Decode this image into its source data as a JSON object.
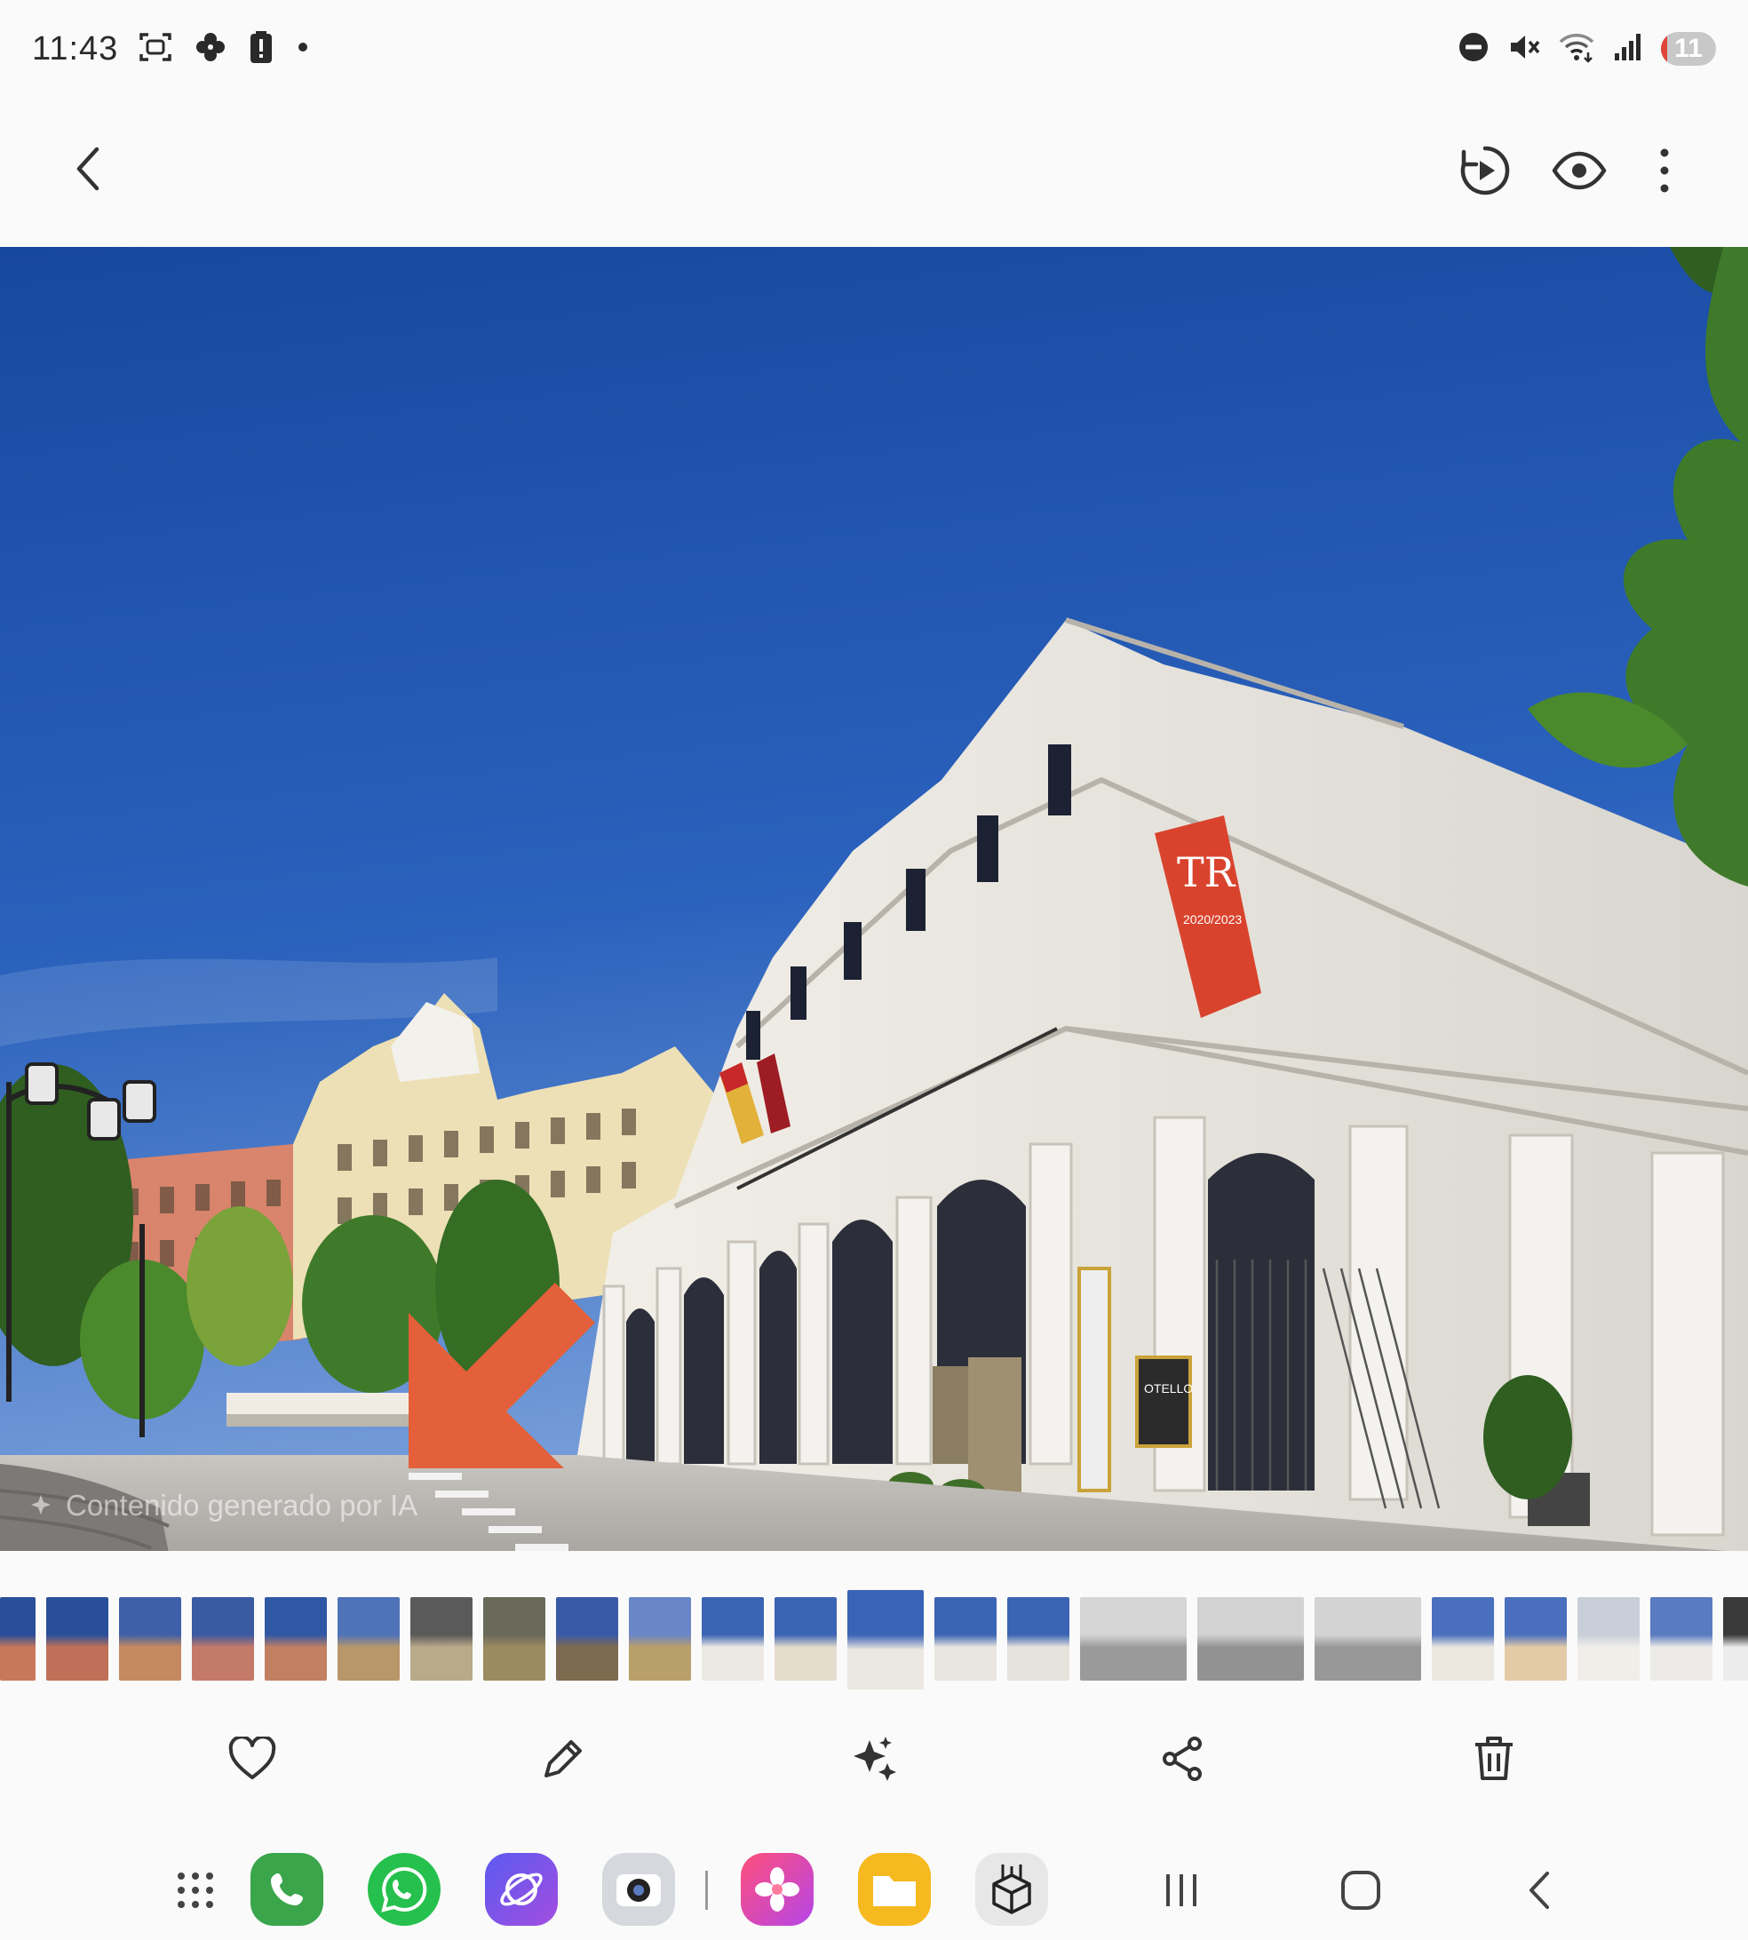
{
  "status_bar": {
    "time": "11:43",
    "battery_level": "11",
    "battery_fraction": 0.11,
    "left_icons": [
      "screenshot-icon",
      "pinwheel-icon",
      "battery-alert-icon",
      "notification-dot-icon"
    ],
    "right_icons": [
      "do-not-disturb-icon",
      "mute-icon",
      "wifi-icon",
      "signal-icon",
      "battery-icon"
    ]
  },
  "top_bar": {
    "icons": [
      "back-icon",
      "motion-photo-icon",
      "view-icon",
      "more-options-icon"
    ]
  },
  "photo": {
    "ai_label": "Contenido generado por IA",
    "colors": {
      "sky_top": "#1c4fa6",
      "sky_bottom": "#6b95d6",
      "building": "#e9e6df",
      "banner": "#d9432d",
      "arrow": "#e3603a",
      "foliage": "#3f7a2a"
    },
    "banner_text": "TR",
    "banner_sub": "2020/2023",
    "poster_text": "OTELLO"
  },
  "filmstrip": {
    "count": 24,
    "active_index": 12
  },
  "actions": {
    "icons": [
      "favorite-icon",
      "edit-icon",
      "ai-sparkle-icon",
      "share-icon",
      "delete-icon"
    ]
  },
  "dock": {
    "apps": [
      "apps-grid-icon",
      "phone-app-icon",
      "whatsapp-app-icon",
      "browser-app-icon",
      "camera-app-icon",
      "gallery-app-icon",
      "files-app-icon",
      "package-app-icon"
    ],
    "nav": [
      "recents-nav-icon",
      "home-nav-icon",
      "back-nav-icon"
    ]
  }
}
